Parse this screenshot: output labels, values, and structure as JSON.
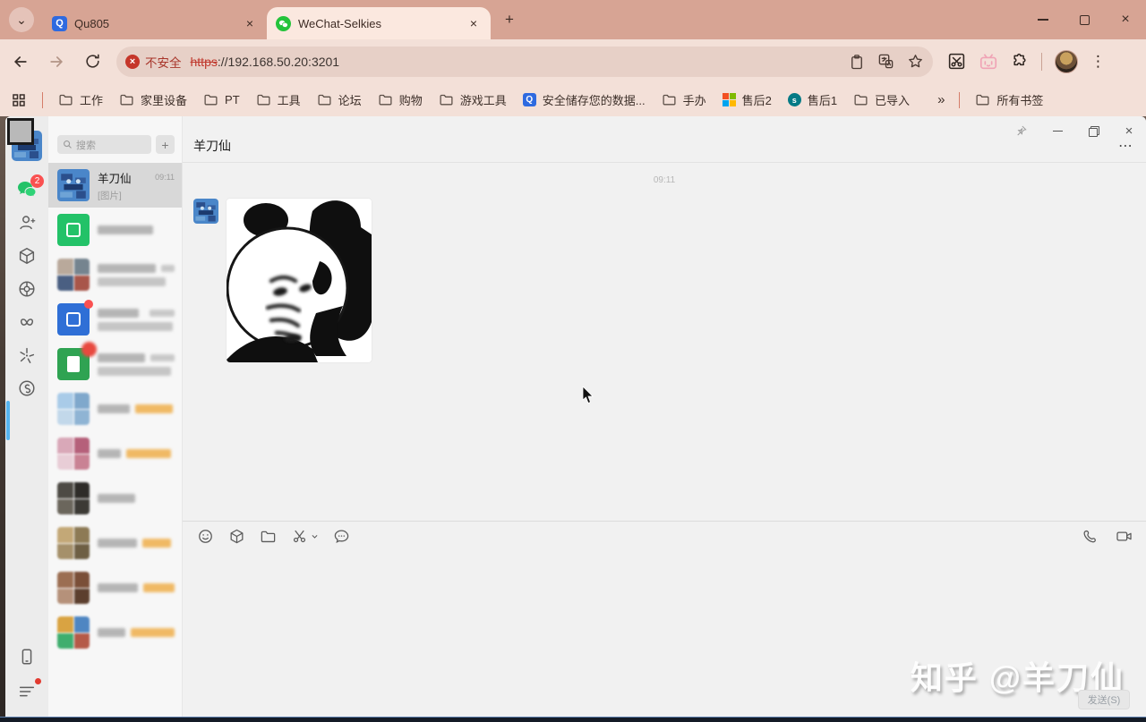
{
  "glyphs": {
    "close": "×",
    "plus": "+",
    "overflow": "»",
    "kebab_v": "⋮",
    "kebab_h": "⋯",
    "chevron_down": "⌄",
    "fav_q": "Q",
    "ms_colors": [
      "#f25022",
      "#7fba00",
      "#00a4ef",
      "#ffb900"
    ],
    "sp_letter": "s"
  },
  "browser": {
    "tabs": [
      {
        "label": "Qu805"
      },
      {
        "label": "WeChat-Selkies"
      }
    ],
    "omnibox": {
      "security_label": "不安全",
      "scheme": "https",
      "url_rest": "://192.168.50.20:3201"
    },
    "bookmarks": [
      {
        "label": "工作",
        "icon": "folder"
      },
      {
        "label": "家里设备",
        "icon": "folder"
      },
      {
        "label": "PT",
        "icon": "folder"
      },
      {
        "label": "工具",
        "icon": "folder"
      },
      {
        "label": "论坛",
        "icon": "folder"
      },
      {
        "label": "购物",
        "icon": "folder"
      },
      {
        "label": "游戏工具",
        "icon": "folder"
      },
      {
        "label": "安全储存您的数据...",
        "icon": "qu"
      },
      {
        "label": "手办",
        "icon": "folder"
      },
      {
        "label": "售后2",
        "icon": "ms"
      },
      {
        "label": "售后1",
        "icon": "sp"
      },
      {
        "label": "已导入",
        "icon": "folder"
      }
    ],
    "all_bookmarks_label": "所有书签"
  },
  "wechat": {
    "nav_badge": "2",
    "search_placeholder": "搜索",
    "chat_list": [
      {
        "name": "羊刀仙",
        "time": "09:11",
        "preview": "[图片]",
        "selected": true,
        "avatar": {
          "kind": "cartoon"
        }
      },
      {
        "avatar": {
          "kind": "solid",
          "color": "#23c268",
          "glyph": "square"
        },
        "blocks": {
          "l1": [
            [
              "g",
              62
            ]
          ]
        }
      },
      {
        "avatar": {
          "kind": "grid",
          "colors": [
            "#b9a99b",
            "#75848f",
            "#4a5f82",
            "#a8564a"
          ]
        },
        "blocks": {
          "l1": [
            [
              "g",
              88
            ]
          ],
          "l2": [
            [
              "g",
              76
            ]
          ],
          "time": 20
        }
      },
      {
        "avatar": {
          "kind": "solid",
          "color": "#2f6fd6",
          "glyph": "square"
        },
        "badge": "dot",
        "blocks": {
          "l1": [
            [
              "g",
              46
            ]
          ],
          "l2": [
            [
              "g",
              84
            ]
          ],
          "time": 28
        }
      },
      {
        "avatar": {
          "kind": "solid",
          "color": "#2fa352",
          "glyph": "doc"
        },
        "badge": "burst",
        "blocks": {
          "l1": [
            [
              "g",
              56
            ]
          ],
          "l2": [
            [
              "g",
              82
            ]
          ],
          "time": 28
        }
      },
      {
        "avatar": {
          "kind": "grid",
          "colors": [
            "#a9cbe8",
            "#7fa8cc",
            "#c2d8ea",
            "#8fb4d4"
          ]
        },
        "blocks": {
          "l1": [
            [
              "g",
              36
            ],
            [
              "o",
              42
            ]
          ]
        }
      },
      {
        "avatar": {
          "kind": "grid",
          "colors": [
            "#d9a8b8",
            "#b5607a",
            "#e8cdd6",
            "#c98294"
          ]
        },
        "blocks": {
          "l1": [
            [
              "g",
              26
            ],
            [
              "o",
              50
            ]
          ]
        }
      },
      {
        "avatar": {
          "kind": "grid",
          "colors": [
            "#4d4a44",
            "#2e2c29",
            "#6b665c",
            "#3c3a35"
          ]
        },
        "blocks": {
          "l1": [
            [
              "g",
              42
            ]
          ]
        }
      },
      {
        "avatar": {
          "kind": "grid",
          "colors": [
            "#c3a877",
            "#8d7a55",
            "#a5906a",
            "#6e5f44"
          ]
        },
        "blocks": {
          "l1": [
            [
              "g",
              44
            ],
            [
              "o",
              32
            ]
          ]
        }
      },
      {
        "avatar": {
          "kind": "grid",
          "colors": [
            "#9b6e52",
            "#7a4f38",
            "#b5917a",
            "#5c3f2e"
          ]
        },
        "blocks": {
          "l1": [
            [
              "g",
              46
            ],
            [
              "o",
              36
            ]
          ]
        }
      },
      {
        "avatar": {
          "kind": "grid",
          "colors": [
            "#d9a342",
            "#4f86c2",
            "#3fae6e",
            "#b55a48"
          ]
        },
        "blocks": {
          "l1": [
            [
              "g",
              48
            ],
            [
              "o",
              74
            ]
          ]
        }
      }
    ],
    "conversation": {
      "title": "羊刀仙",
      "timestamp": "09:11"
    },
    "composer": {
      "send_label": "发送(S)"
    },
    "watermark": "知乎 @羊刀仙"
  }
}
